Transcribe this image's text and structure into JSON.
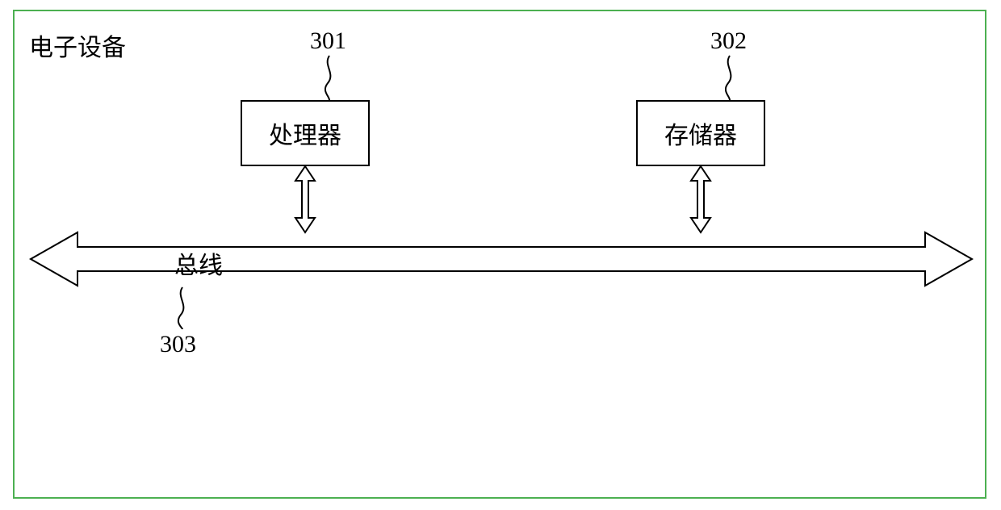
{
  "title": "电子设备",
  "components": {
    "processor": {
      "ref": "301",
      "label": "处理器"
    },
    "memory": {
      "ref": "302",
      "label": "存储器"
    },
    "bus": {
      "ref": "303",
      "label": "总线"
    }
  }
}
